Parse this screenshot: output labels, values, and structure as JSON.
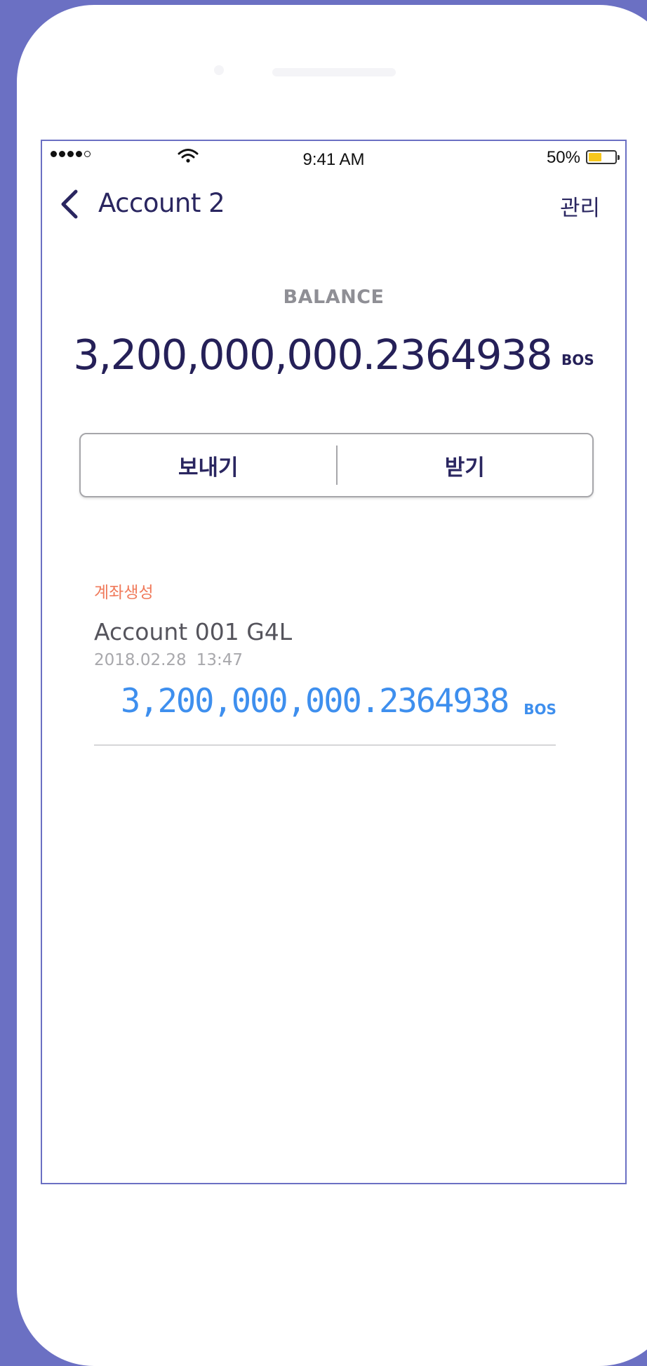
{
  "status_bar": {
    "time": "9:41 AM",
    "battery_percent": "50%",
    "battery_level": 0.5,
    "signal_bars_filled": 4,
    "signal_bars_total": 5
  },
  "nav": {
    "back_icon": "chevron-left-icon",
    "title": "Account 2",
    "manage_label": "관리"
  },
  "balance": {
    "label": "BALANCE",
    "amount": "3,200,000,000.2364938",
    "unit": "BOS"
  },
  "actions": {
    "send_label": "보내기",
    "receive_label": "받기"
  },
  "transactions": [
    {
      "tag": "계좌생성",
      "name": "Account 001 G4L",
      "date": "2018.02.28",
      "time": "13:47",
      "amount": "3,200,000,000.2364938",
      "unit": "BOS"
    }
  ],
  "colors": {
    "background": "#6b70c3",
    "title_navy": "#2a2660",
    "tag_orange": "#f07b5c",
    "amount_blue": "#3e8fee",
    "battery_yellow": "#f7c71d"
  }
}
